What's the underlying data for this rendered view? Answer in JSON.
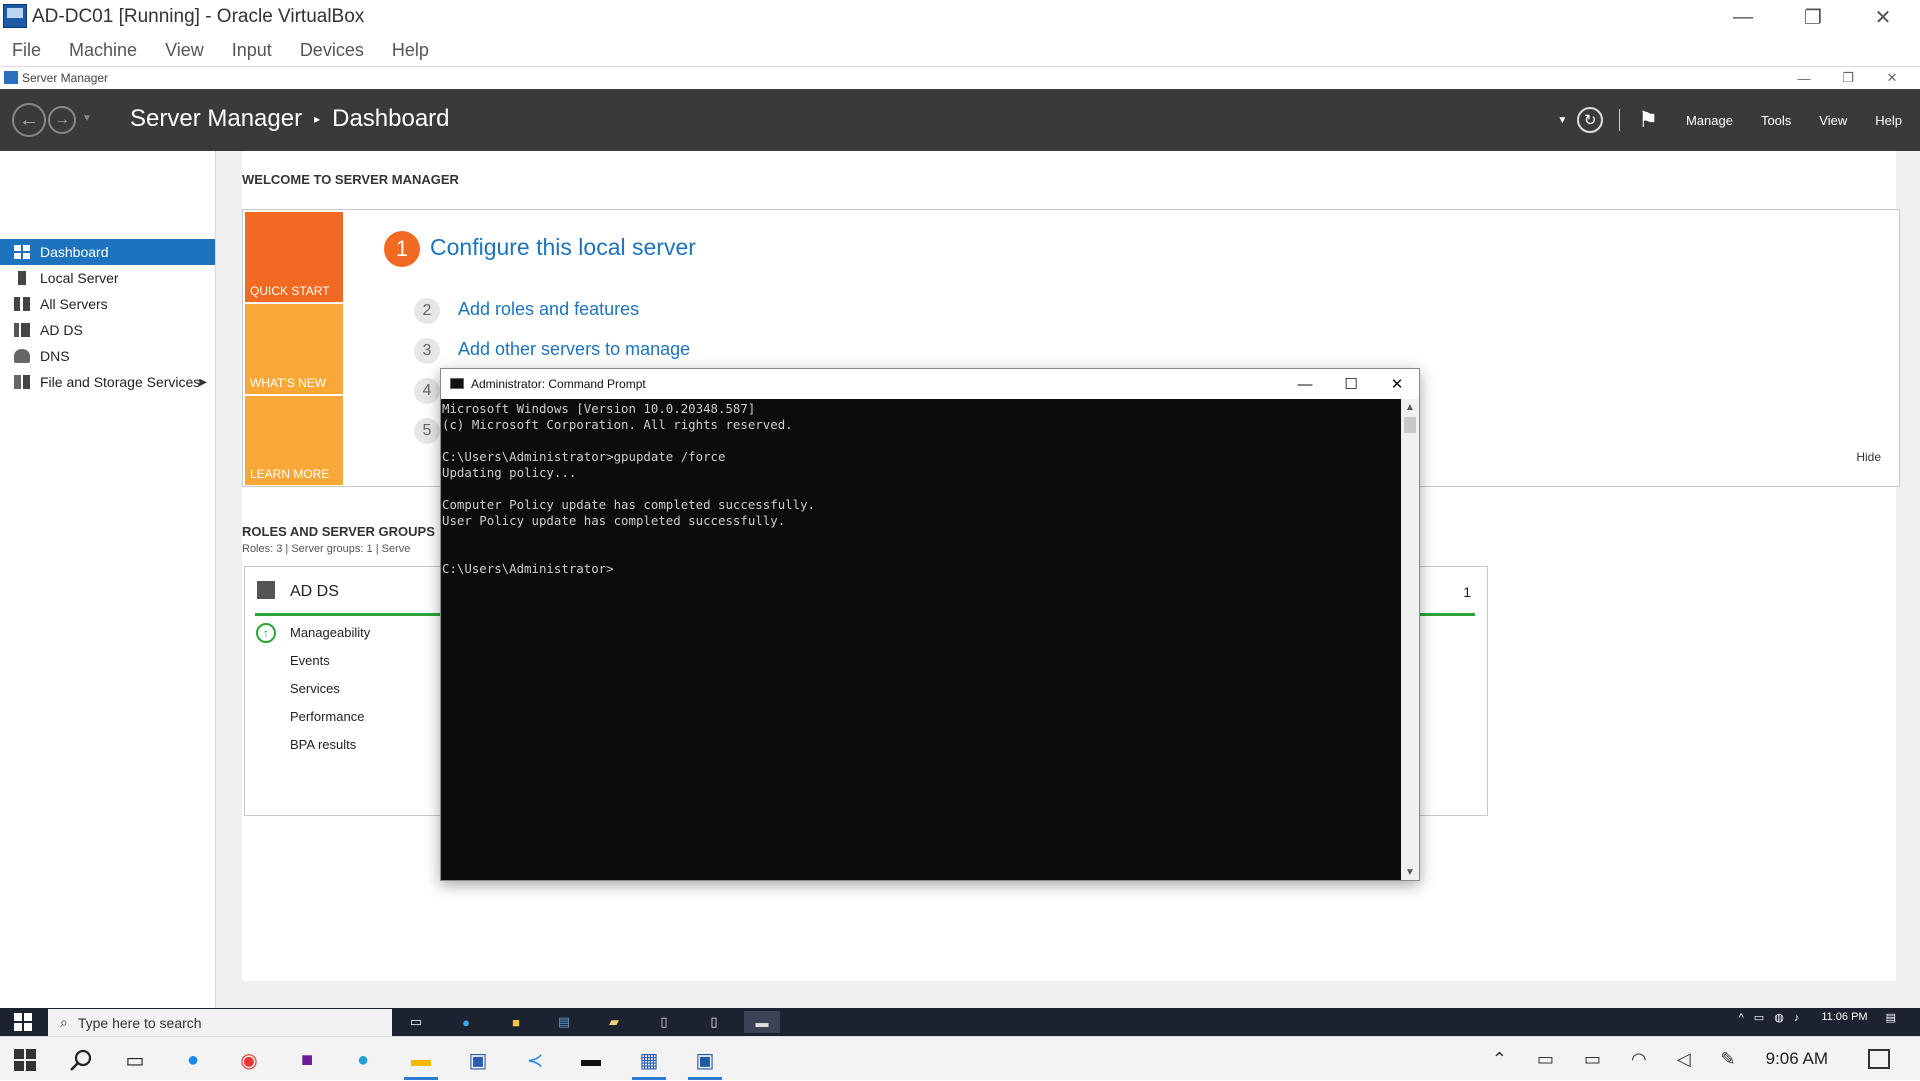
{
  "host_window": {
    "title": "AD-DC01 [Running] - Oracle VirtualBox",
    "menu": [
      "File",
      "Machine",
      "View",
      "Input",
      "Devices",
      "Help"
    ],
    "controls": {
      "minimize": "—",
      "restore": "❐",
      "close": "✕"
    }
  },
  "server_manager": {
    "window_title": "Server Manager",
    "controls": {
      "minimize": "—",
      "restore": "❐",
      "close": "✕"
    },
    "header": {
      "breadcrumb_app": "Server Manager",
      "breadcrumb_sep": "▸",
      "breadcrumb_page": "Dashboard",
      "menu": [
        "Manage",
        "Tools",
        "View",
        "Help"
      ]
    },
    "nav": [
      {
        "label": "Dashboard",
        "icon": "dashboard-icon",
        "active": true
      },
      {
        "label": "Local Server",
        "icon": "server-icon"
      },
      {
        "label": "All Servers",
        "icon": "servers-icon"
      },
      {
        "label": "AD DS",
        "icon": "ad-ds-icon"
      },
      {
        "label": "DNS",
        "icon": "dns-icon"
      },
      {
        "label": "File and Storage Services",
        "icon": "storage-icon",
        "expandable": true
      }
    ],
    "welcome": {
      "heading": "WELCOME TO SERVER MANAGER",
      "tiles": [
        "QUICK START",
        "WHAT'S NEW",
        "LEARN MORE"
      ],
      "step1": {
        "num": "1",
        "label": "Configure this local server"
      },
      "steps": [
        {
          "num": "2",
          "label": "Add roles and features"
        },
        {
          "num": "3",
          "label": "Add other servers to manage"
        },
        {
          "num": "4",
          "label": ""
        },
        {
          "num": "5",
          "label": ""
        }
      ],
      "hide": "Hide"
    },
    "roles": {
      "heading": "ROLES AND SERVER GROUPS",
      "summary": "Roles: 3   |   Server groups: 1   |   Serve",
      "card": {
        "title": "AD DS",
        "count": "1",
        "items": [
          "Manageability",
          "Events",
          "Services",
          "Performance",
          "BPA results"
        ]
      }
    }
  },
  "cmd": {
    "title": "Administrator: Command Prompt",
    "controls": {
      "minimize": "—",
      "maximize": "☐",
      "close": "✕"
    },
    "output": "Microsoft Windows [Version 10.0.20348.587]\n(c) Microsoft Corporation. All rights reserved.\n\nC:\\Users\\Administrator>gpupdate /force\nUpdating policy...\n\nComputer Policy update has completed successfully.\nUser Policy update has completed successfully.\n\n\nC:\\Users\\Administrator>"
  },
  "guest_taskbar": {
    "search_placeholder": "Type here to search",
    "clock_time": "11:06 PM"
  },
  "host_taskbar": {
    "clock": "9:06 AM",
    "apps": [
      "windows-start-icon",
      "search-icon",
      "task-view-icon",
      "edge-icon",
      "chrome-icon",
      "media-app-icon",
      "telegram-icon",
      "file-explorer-icon",
      "app-icon",
      "vscode-icon",
      "terminal-icon",
      "virtualbox-icon",
      "ad-vm-icon"
    ]
  },
  "colors": {
    "accent": "#1e73be",
    "quick_start": "#f26a21",
    "tiles": "#f9a837",
    "header": "#3a3a3a",
    "healthy": "#2aa536"
  }
}
